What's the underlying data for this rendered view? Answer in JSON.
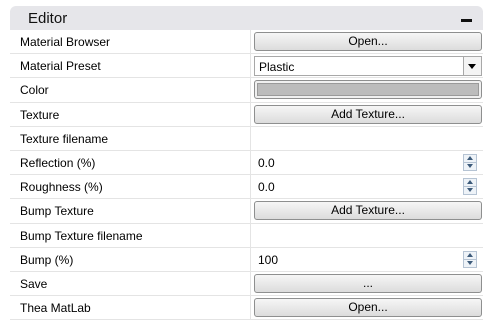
{
  "panel": {
    "title": "Editor"
  },
  "rows": {
    "material_browser": {
      "label": "Material Browser",
      "button": "Open..."
    },
    "material_preset": {
      "label": "Material Preset",
      "value": "Plastic"
    },
    "color": {
      "label": "Color",
      "swatch": "#bcbcbc"
    },
    "texture": {
      "label": "Texture",
      "button": "Add Texture..."
    },
    "texture_filename": {
      "label": "Texture filename",
      "value": ""
    },
    "reflection": {
      "label": "Reflection (%)",
      "value": "0.0"
    },
    "roughness": {
      "label": "Roughness (%)",
      "value": "0.0"
    },
    "bump_texture": {
      "label": "Bump Texture",
      "button": "Add Texture..."
    },
    "bump_texture_filename": {
      "label": "Bump Texture filename",
      "value": ""
    },
    "bump": {
      "label": "Bump (%)",
      "value": "100"
    },
    "save": {
      "label": "Save",
      "button": "..."
    },
    "thea_matlab": {
      "label": "Thea MatLab",
      "button": "Open..."
    }
  },
  "icons": {
    "collapse": "minus-icon",
    "dropdown": "chevron-down-icon",
    "spinner": "spinner-arrows-icon"
  }
}
